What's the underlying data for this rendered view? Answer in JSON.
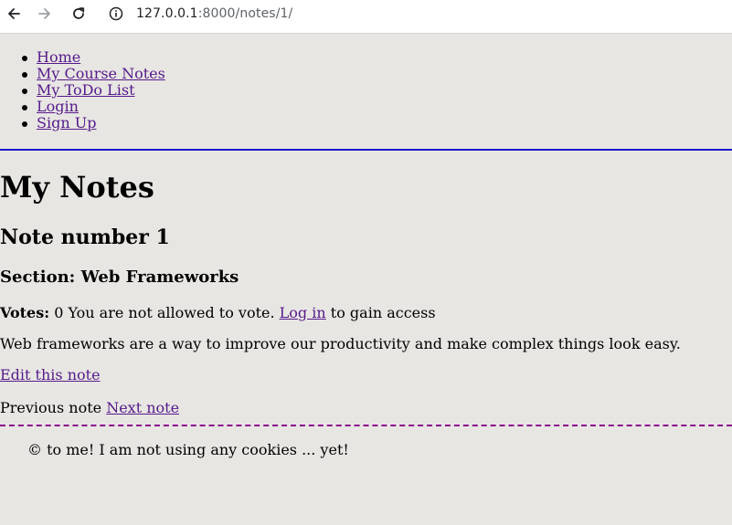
{
  "browser": {
    "url_host": "127.0.0.1",
    "url_rest": ":8000/notes/1/"
  },
  "nav": {
    "items": [
      {
        "label": "Home"
      },
      {
        "label": "My Course Notes"
      },
      {
        "label": "My ToDo List"
      },
      {
        "label": "Login"
      },
      {
        "label": "Sign Up"
      }
    ]
  },
  "main": {
    "title": "My Notes",
    "note_title": "Note number 1",
    "section": "Section: Web Frameworks",
    "votes_label": "Votes:",
    "votes_value": "0",
    "vote_message": "You are not allowed to vote.",
    "login_link": "Log in",
    "login_suffix": "to gain access",
    "description": "Web frameworks are a way to improve our productivity and make complex things look easy.",
    "edit_link": "Edit this note",
    "previous_label": "Previous note",
    "next_link": "Next note"
  },
  "footer": {
    "text": "© to me! I am not using any cookies ... yet!"
  },
  "colors": {
    "page_bg": "#e8e6e3",
    "link": "#551a8b",
    "rule_top": "#1a1acc",
    "rule_bottom": "#8a008a"
  }
}
